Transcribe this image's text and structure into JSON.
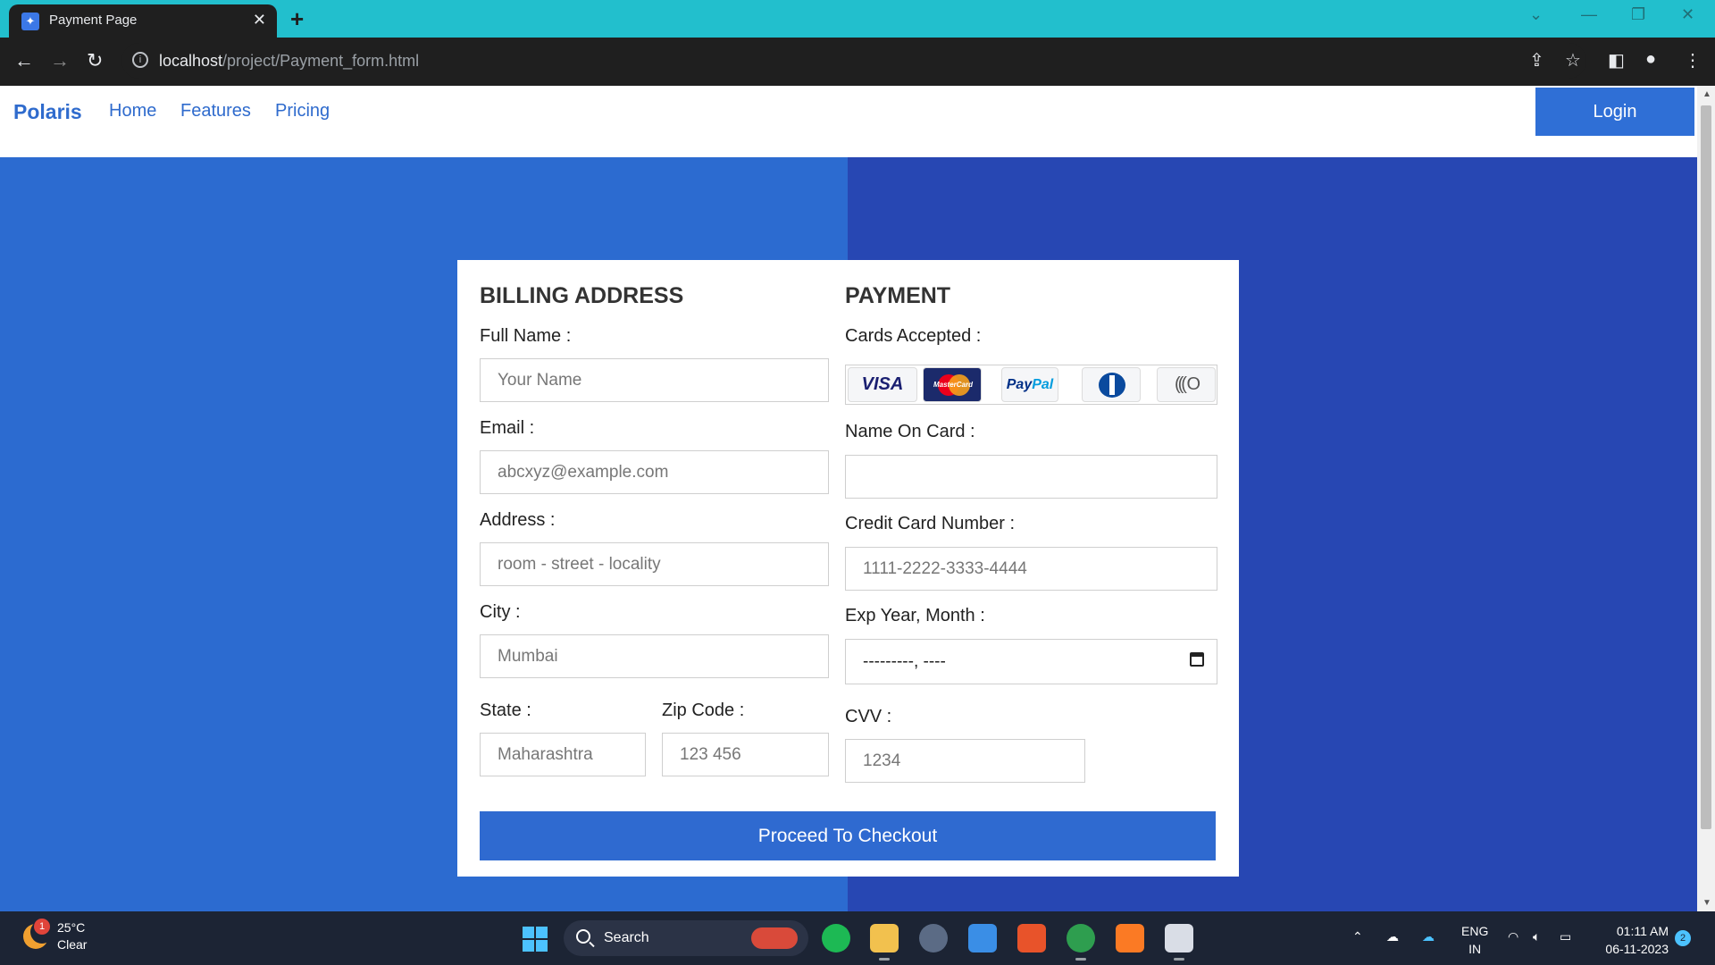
{
  "browser": {
    "tab_title": "Payment Page",
    "url_host": "localhost",
    "url_path": "/project/Payment_form.html"
  },
  "site": {
    "brand": "Polaris",
    "nav": [
      "Home",
      "Features",
      "Pricing"
    ],
    "login_label": "Login"
  },
  "billing": {
    "title": "BILLING ADDRESS",
    "full_name_label": "Full Name :",
    "full_name_placeholder": "Your Name",
    "email_label": "Email :",
    "email_placeholder": "abcxyz@example.com",
    "address_label": "Address :",
    "address_placeholder": "room - street - locality",
    "city_label": "City :",
    "city_placeholder": "Mumbai",
    "state_label": "State :",
    "state_placeholder": "Maharashtra",
    "zip_label": "Zip Code :",
    "zip_placeholder": "123 456"
  },
  "payment": {
    "title": "PAYMENT",
    "cards_label": "Cards Accepted :",
    "card_brands": [
      "VISA",
      "MasterCard",
      "PayPal",
      "Diners Club",
      "contactless"
    ],
    "name_on_card_label": "Name On Card :",
    "card_number_label": "Credit Card Number :",
    "card_number_placeholder": "1111-2222-3333-4444",
    "exp_label": "Exp Year, Month :",
    "exp_value": "---------, ----",
    "cvv_label": "CVV :",
    "cvv_placeholder": "1234"
  },
  "checkout_label": "Proceed To Checkout",
  "taskbar": {
    "weather_badge": "1",
    "temperature": "25°C",
    "condition": "Clear",
    "search_label": "Search",
    "lang_1": "ENG",
    "lang_2": "IN",
    "time": "01:11 AM",
    "date": "06-11-2023",
    "notification_count": "2"
  },
  "colors": {
    "left_bg": "#2c6bd0",
    "right_bg": "#2747b3",
    "accent": "#2f6ad0"
  }
}
